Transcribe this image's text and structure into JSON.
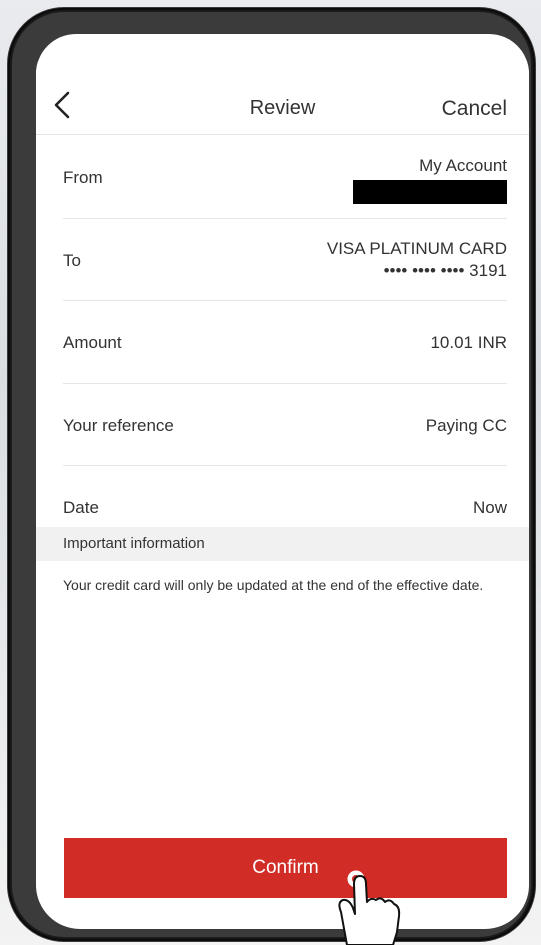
{
  "header": {
    "title": "Review",
    "cancel_label": "Cancel"
  },
  "rows": [
    {
      "label": "From",
      "value": "My Account"
    },
    {
      "label": "To",
      "value": "VISA PLATINUM CARD",
      "value_secondary": "•••• •••• •••• 3191"
    },
    {
      "label": "Amount",
      "value": "10.01 INR"
    },
    {
      "label": "Your reference",
      "value": "Paying CC"
    },
    {
      "label": "Date",
      "value": "Now"
    }
  ],
  "info": {
    "heading": "Important information",
    "text": "Your credit card will only be updated at the end of the effective date."
  },
  "confirm_label": "Confirm",
  "colors": {
    "accent": "#d22c26",
    "text": "#333333",
    "divider": "#e6e6e6",
    "info_bg": "#f1f1f1"
  },
  "icons": [
    "back-chevron-icon",
    "tap-hand-icon"
  ]
}
